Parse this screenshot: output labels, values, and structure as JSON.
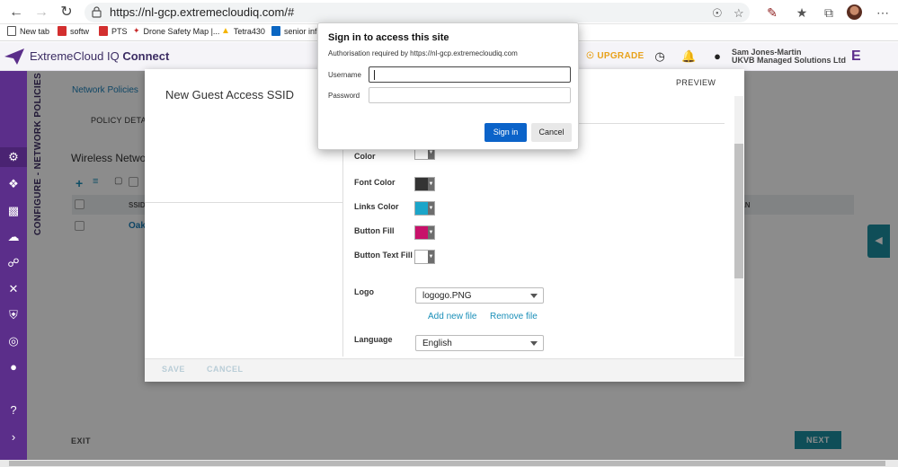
{
  "browser": {
    "url": "https://nl-gcp.extremecloudiq.com/#",
    "bookmarks": [
      {
        "label": "New tab",
        "color": "#555555"
      },
      {
        "label": "softw",
        "color": "#d32f2f"
      },
      {
        "label": "PTS",
        "color": "#d32f2f"
      },
      {
        "label": "Drone Safety Map |...",
        "color": "#c62828"
      },
      {
        "label": "Tetra430",
        "color": "#f4b400"
      },
      {
        "label": "senior info",
        "color": "#0a66c2"
      }
    ]
  },
  "app": {
    "title_light": "ExtremeCloud IQ",
    "title_bold": "Connect",
    "upgrade": "UPGRADE",
    "user_name": "Sam Jones-Martin",
    "user_org": "UKVB Managed Solutions Ltd",
    "brand_letter": "E",
    "accent_color": "#5b2e8a"
  },
  "background": {
    "vertical_title": "CONFIGURE - NETWORK POLICIES",
    "breadcrumb": "Network Policies",
    "policy_tab": "POLICY DETAIL",
    "section_title": "Wireless Netwo",
    "col_ssid": "SSID",
    "col_right": "AN",
    "row_ssid": "Oak",
    "exit": "EXIT",
    "next": "NEXT"
  },
  "modal": {
    "title": "New Guest Access SSID",
    "preview": "PREVIEW",
    "fields": {
      "bg_color_label": "Color",
      "font_color_label": "Font Color",
      "links_color_label": "Links Color",
      "button_fill_label": "Button Fill",
      "button_text_fill_label": "Button Text Fill",
      "logo_label": "Logo",
      "logo_value": "logogo.PNG",
      "add_file": "Add new file",
      "remove_file": "Remove file",
      "language_label": "Language",
      "language_value": "English"
    },
    "colors": {
      "bg": "#ffffff",
      "font": "#333333",
      "links": "#1ba5c9",
      "button_fill": "#c8116a",
      "button_text": "#ffffff"
    },
    "save": "SAVE",
    "cancel": "CANCEL"
  },
  "auth": {
    "title": "Sign in to access this site",
    "subtitle": "Authorisation required by https://nl-gcp.extremecloudiq.com",
    "username_label": "Username",
    "username_value": "",
    "password_label": "Password",
    "password_value": "",
    "sign_in": "Sign in",
    "cancel": "Cancel"
  }
}
